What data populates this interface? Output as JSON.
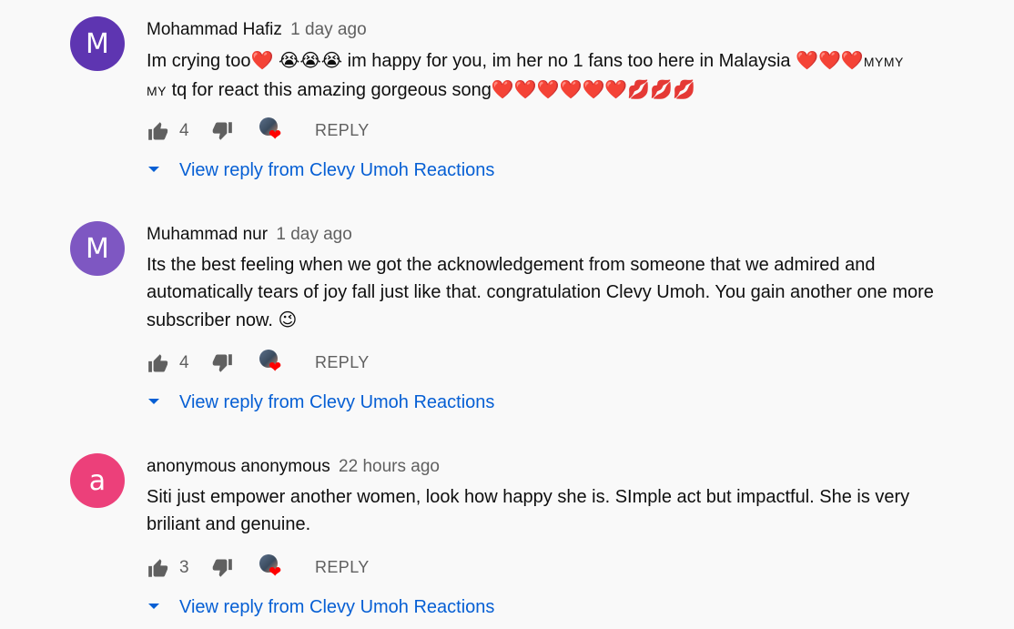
{
  "comments": [
    {
      "author": "Mohammad Hafiz",
      "time": "1 day ago",
      "avatar_letter": "M",
      "avatar_color": "#5e35b1",
      "text_line1_a": "Im crying too",
      "text_line1_b": "im happy for you, im her no 1 fans too here in Malaysia",
      "text_line1_c": "MYMY",
      "text_line2_a": "MY",
      "text_line2_b": "tq for react this amazing gorgeous song",
      "likes": "4",
      "reply_label": "REPLY",
      "view_reply": "View reply from Clevy Umoh Reactions"
    },
    {
      "author": "Muhammad nur",
      "time": "1 day ago",
      "avatar_letter": "M",
      "avatar_color": "#7e57c2",
      "text": "Its the best feeling when we got the acknowledgement from someone that we admired and automatically tears of joy fall just like that. congratulation Clevy Umoh. You gain another one more subscriber now.",
      "likes": "4",
      "reply_label": "REPLY",
      "view_reply": "View reply from Clevy Umoh Reactions"
    },
    {
      "author": "anonymous anonymous",
      "time": "22 hours ago",
      "avatar_letter": "a",
      "avatar_color": "#ec407a",
      "text": "Siti just empower another women, look how happy she is. SImple act but impactful. She is very briliant and genuine.",
      "likes": "3",
      "reply_label": "REPLY",
      "view_reply": "View reply from Clevy Umoh Reactions"
    }
  ],
  "icons": {
    "like": "thumbs-up-icon",
    "dislike": "thumbs-down-icon",
    "creator_heart": "creator-heart-icon",
    "expand": "caret-down-icon"
  },
  "colors": {
    "link": "#065fd4",
    "heart": "#ff0000",
    "secondary_text": "#606060"
  }
}
